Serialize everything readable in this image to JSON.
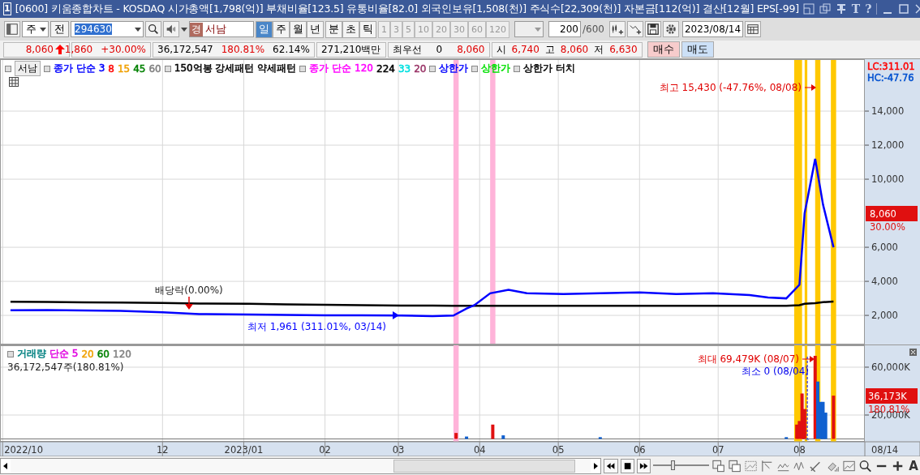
{
  "window": {
    "badge": "1",
    "title": "[0600] 키움종합차트 - KOSDAQ 시가총액[1,798(억)] 부채비율[123.5] 유통비율[82.0] 외국인보유[1,508(천)] 주식수[22,309(천)] 자본금[112(억)] 결산[12월] EPS[-99]",
    "text_buttons": [
      "T",
      "?"
    ]
  },
  "toolbar": {
    "market": "주",
    "prev_button": "전",
    "code": "294630",
    "exchange_badge": "경",
    "stock_name": "서남",
    "periods": [
      {
        "label": "일",
        "selected": true
      },
      {
        "label": "주",
        "selected": false
      },
      {
        "label": "월",
        "selected": false
      },
      {
        "label": "년",
        "selected": false
      }
    ],
    "intraday": [
      {
        "label": "분",
        "selected": false
      },
      {
        "label": "초",
        "selected": false
      },
      {
        "label": "틱",
        "selected": false
      }
    ],
    "intervals": [
      {
        "label": "1",
        "disabled": true
      },
      {
        "label": "3",
        "disabled": true
      },
      {
        "label": "5",
        "disabled": true
      },
      {
        "label": "10",
        "disabled": true
      },
      {
        "label": "20",
        "disabled": true
      },
      {
        "label": "30",
        "disabled": true
      },
      {
        "label": "60",
        "disabled": true
      },
      {
        "label": "120",
        "disabled": true
      }
    ],
    "count": "200",
    "max_count": "/600",
    "date": "2023/08/14"
  },
  "quote": {
    "price": "8,060",
    "change": "1,860",
    "change_rate": "+30.00%",
    "volume": "36,172,547",
    "volume_rate": "180.81%",
    "turnover": "62.14%",
    "amount": "271,210백만",
    "best_label": "최우선",
    "best_qty": "0",
    "best_price": "8,060",
    "open_label": "시",
    "open": "6,740",
    "high_label": "고",
    "high": "8,060",
    "low_label": "저",
    "low": "6,630",
    "buy_button": "매수",
    "sell_button": "매도"
  },
  "price_pane": {
    "stock_tag": "서남",
    "legend": [
      [
        {
          "text": "종가 단순 3",
          "color": "#0000ff"
        },
        {
          "text": "8",
          "color": "#ff0000"
        },
        {
          "text": "15",
          "color": "#f0a000"
        },
        {
          "text": "45",
          "color": "#008000"
        },
        {
          "text": "60",
          "color": "#808080"
        }
      ],
      [
        {
          "text": "150억봉 강세패턴",
          "color": "#000000"
        },
        {
          "text": "약세패턴",
          "color": "#000000"
        }
      ],
      [
        {
          "text": "종가 단순 120",
          "color": "#ff00ff"
        },
        {
          "text": "224",
          "color": "#000000"
        },
        {
          "text": "33",
          "color": "#00e0e0"
        },
        {
          "text": "20",
          "color": "#993366"
        }
      ],
      [
        {
          "text": "상한가",
          "color": "#0000ff"
        }
      ],
      [
        {
          "text": "상한가",
          "color": "#00e000"
        }
      ],
      [
        {
          "text": "상한가 터치",
          "color": "#000000"
        }
      ]
    ],
    "corner": [
      {
        "text": "LC:311.01",
        "color": "#ff0000"
      },
      {
        "text": "HC:-47.76",
        "color": "#0050d0"
      }
    ],
    "last_tag": {
      "value": "8,060",
      "change": "30.00%"
    },
    "high_label": "최고 15,430 (-47.76%, 08/08)",
    "low_label": "최저 1,961 (311.01%, 03/14)",
    "event_label": "배당락(0.00%)",
    "chart_data": {
      "type": "line",
      "grid": true,
      "xlim": [
        "2022-09-30",
        "2023-09-16"
      ],
      "ylim": [
        290,
        17050
      ],
      "x": [
        "2022-10-04",
        "2022-10-18",
        "2022-11-01",
        "2022-11-15",
        "2022-12-01",
        "2022-12-15",
        "2023-01-03",
        "2023-01-17",
        "2023-02-01",
        "2023-02-15",
        "2023-03-02",
        "2023-03-14",
        "2023-03-22",
        "2023-03-27",
        "2023-03-30",
        "2023-04-05",
        "2023-04-12",
        "2023-04-19",
        "2023-05-03",
        "2023-05-17",
        "2023-06-01",
        "2023-06-15",
        "2023-06-29",
        "2023-07-13",
        "2023-07-20",
        "2023-07-27",
        "2023-08-01",
        "2023-08-03",
        "2023-08-07",
        "2023-08-10",
        "2023-08-14"
      ],
      "series": [
        {
          "color": "#0000ff",
          "values": [
            2300,
            2320,
            2290,
            2270,
            2180,
            2080,
            2050,
            2030,
            2010,
            2000,
            1990,
            1960,
            1990,
            2400,
            2600,
            3300,
            3500,
            3300,
            3250,
            3300,
            3350,
            3250,
            3300,
            3200,
            3050,
            3000,
            3800,
            8000,
            11200,
            8500,
            6000
          ]
        },
        {
          "color": "#000000",
          "values": [
            2800,
            2790,
            2770,
            2750,
            2730,
            2700,
            2680,
            2650,
            2620,
            2600,
            2580,
            2570,
            2560,
            2560,
            2560,
            2560,
            2560,
            2560,
            2560,
            2560,
            2560,
            2560,
            2560,
            2560,
            2560,
            2560,
            2600,
            2680,
            2720,
            2780,
            2810
          ]
        }
      ],
      "yticks": [
        {
          "value": 2000,
          "label": "2,000"
        },
        {
          "value": 4000,
          "label": "4,000"
        },
        {
          "value": 6000,
          "label": "6,000"
        },
        {
          "value": 10000,
          "label": "10,000"
        },
        {
          "value": 12000,
          "label": "12,000"
        },
        {
          "value": 14000,
          "label": "14,000"
        }
      ],
      "bands": [
        {
          "axis": "x",
          "from": "2023-03-22",
          "to": "2023-03-24",
          "color": "#ffb3d9"
        },
        {
          "axis": "x",
          "from": "2023-04-05",
          "to": "2023-04-07",
          "color": "#ffb3d9"
        },
        {
          "axis": "x",
          "from": "2023-07-30",
          "to": "2023-08-02",
          "color": "#ffc800"
        },
        {
          "axis": "x",
          "from": "2023-08-03",
          "to": "2023-08-04",
          "color": "#ffc800"
        },
        {
          "axis": "x",
          "from": "2023-08-07",
          "to": "2023-08-09",
          "color": "#ffc800"
        },
        {
          "axis": "x",
          "from": "2023-08-13",
          "to": "2023-08-15",
          "color": "#ffc800"
        }
      ]
    }
  },
  "volume_pane": {
    "legend": [
      {
        "text": "거래량",
        "color": "#008080"
      },
      {
        "text": "단순 5",
        "color": "#e000e0"
      },
      {
        "text": "20",
        "color": "#f0a000"
      },
      {
        "text": "60",
        "color": "#008000"
      },
      {
        "text": "120",
        "color": "#808080"
      }
    ],
    "summary": "36,172,547주(180.81%)",
    "last_tag": {
      "value": "36,173K",
      "change": "180.81%"
    },
    "max_label": "최대 69,479K (08/07)",
    "min_label": "최소 0 (08/04)",
    "chart_data": {
      "type": "bar",
      "grid": true,
      "xlim": [
        "2022-09-30",
        "2023-09-16"
      ],
      "ylim": [
        -2370,
        78300
      ],
      "x": [
        "2023-03-23",
        "2023-03-27",
        "2023-04-06",
        "2023-04-10",
        "2023-05-17",
        "2023-07-27",
        "2023-07-31",
        "2023-08-01",
        "2023-08-02",
        "2023-08-03",
        "2023-08-04",
        "2023-08-07",
        "2023-08-08",
        "2023-08-09",
        "2023-08-10",
        "2023-08-11",
        "2023-08-14"
      ],
      "series": [
        {
          "color": "#e01010",
          "values": [
            5000,
            null,
            12000,
            null,
            null,
            null,
            12000,
            15000,
            38000,
            25000,
            null,
            69500,
            null,
            null,
            null,
            null,
            36200
          ]
        },
        {
          "color": "#1060d0",
          "values": [
            null,
            2000,
            null,
            3000,
            1500,
            1500,
            null,
            null,
            null,
            null,
            0,
            null,
            48000,
            31000,
            31000,
            22000,
            null
          ]
        }
      ],
      "xticks": [
        {
          "value": "2022-10-01",
          "label": "2022/10"
        },
        {
          "value": "2022-12-01",
          "label": "12"
        },
        {
          "value": "2023-01-01",
          "label": "2023/01"
        },
        {
          "value": "2023-02-01",
          "label": "02"
        },
        {
          "value": "2023-03-01",
          "label": "03"
        },
        {
          "value": "2023-04-01",
          "label": "04"
        },
        {
          "value": "2023-05-01",
          "label": "05"
        },
        {
          "value": "2023-06-01",
          "label": "06"
        },
        {
          "value": "2023-07-01",
          "label": "07"
        },
        {
          "value": "2023-08-01",
          "label": "08"
        }
      ],
      "yticks": [
        {
          "value": 20000,
          "label": "20,000K"
        },
        {
          "value": 60000,
          "label": "60,000K"
        }
      ],
      "ref_lines": [
        {
          "axis": "x",
          "value": "2023-08-04",
          "color": "#0000ee"
        }
      ],
      "bands": [
        {
          "axis": "x",
          "from": "2023-03-22",
          "to": "2023-03-24",
          "color": "#ffb3d9"
        },
        {
          "axis": "x",
          "from": "2023-07-30",
          "to": "2023-08-02",
          "color": "#ffc800"
        },
        {
          "axis": "x",
          "from": "2023-08-03",
          "to": "2023-08-04",
          "color": "#ffc800"
        },
        {
          "axis": "x",
          "from": "2023-08-07",
          "to": "2023-08-09",
          "color": "#ffc800"
        },
        {
          "axis": "x",
          "from": "2023-08-13",
          "to": "2023-08-15",
          "color": "#ffc800"
        }
      ]
    }
  },
  "x_axis": {
    "end_label": "08/14"
  },
  "bottom": {
    "zoom_slider": {
      "level": 0.36
    },
    "text_button": "A"
  }
}
